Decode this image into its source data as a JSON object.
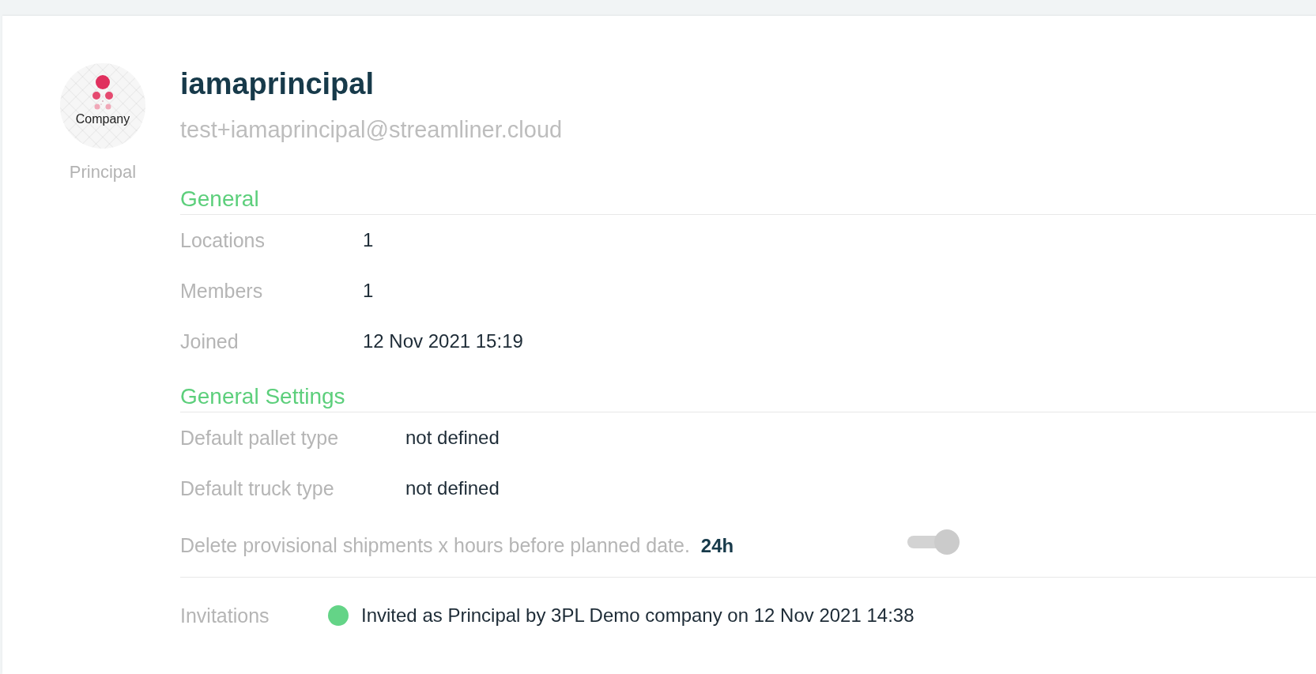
{
  "profile": {
    "logo_text": "Company",
    "role": "Principal",
    "name": "iamaprincipal",
    "email": "test+iamaprincipal@streamliner.cloud"
  },
  "sections": [
    {
      "title": "General",
      "rows": [
        {
          "label": "Locations",
          "value": "1"
        },
        {
          "label": "Members",
          "value": "1"
        },
        {
          "label": "Joined",
          "value": "12 Nov 2021 15:19"
        }
      ]
    },
    {
      "title": "General Settings",
      "rows": [
        {
          "label": "Default pallet type",
          "value": "not defined"
        },
        {
          "label": "Default truck type",
          "value": "not defined"
        }
      ]
    }
  ],
  "provisional_setting": {
    "label": "Delete provisional shipments x hours before planned date.",
    "value": "24h",
    "toggle": {
      "on": true,
      "disabled": true
    }
  },
  "invitations": {
    "label": "Invitations",
    "items": [
      {
        "text": "Invited as Principal by 3PL Demo company on 12 Nov 2021 14:38",
        "color": "#64d487"
      }
    ]
  }
}
